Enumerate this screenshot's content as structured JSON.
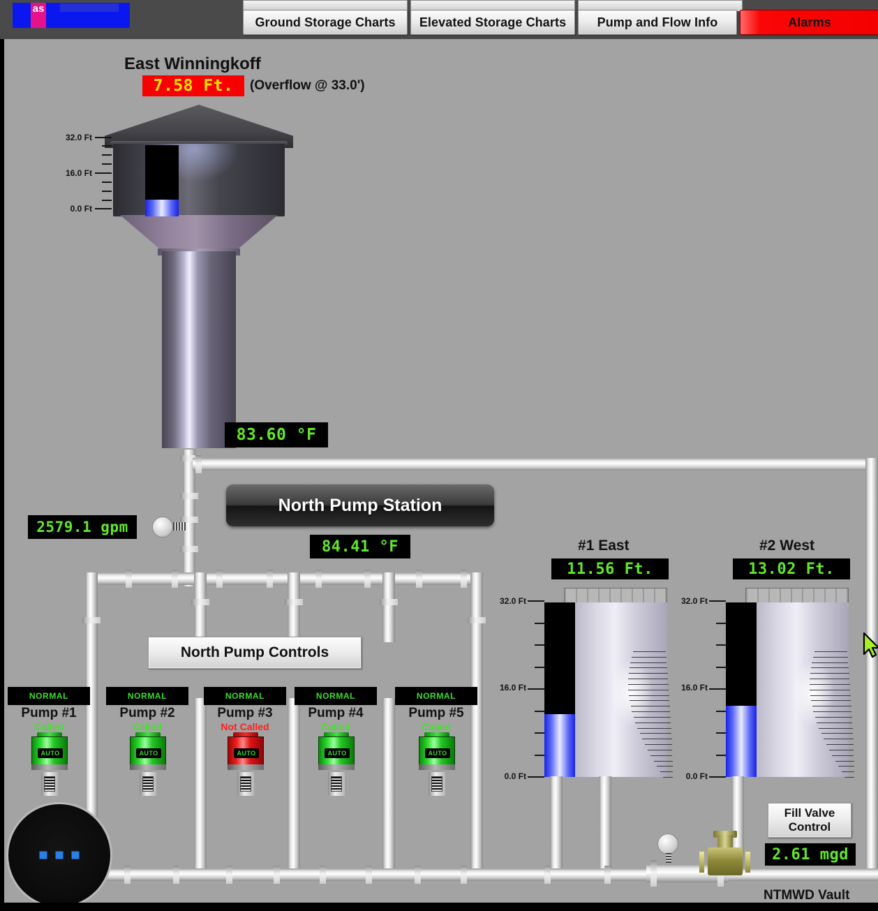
{
  "app": {
    "background_color": "#a3a3a3",
    "logo_text": "as"
  },
  "tabs": [
    {
      "label": "Ground Storage Charts",
      "state": "normal"
    },
    {
      "label": "Elevated Storage Charts",
      "state": "normal"
    },
    {
      "label": "Pump and Flow Info",
      "state": "normal"
    },
    {
      "label": "Alarms",
      "state": "alarm",
      "color": "#f40000"
    }
  ],
  "elevated_tank": {
    "name": "East Winningkoff",
    "level": "7.58 Ft.",
    "level_numeric": 7.58,
    "level_color_bg": "#f90000",
    "level_color_fg": "#ffe400",
    "overflow_note": "(Overflow @ 33.0')",
    "overflow_numeric": 33.0,
    "scale": {
      "top": "32.0 Ft",
      "mid": "16.0 Ft",
      "bottom": "0.0 Ft",
      "max": 32.0,
      "min": 0.0
    },
    "riser_temperature": "83.60 °F"
  },
  "flow": {
    "north_flow": "2579.1 gpm",
    "north_flow_numeric": 2579.1,
    "station_temperature": "84.41 °F"
  },
  "station": {
    "title": "North Pump Station",
    "controls_button": "North Pump Controls"
  },
  "pumps": [
    {
      "status": "NORMAL",
      "name": "Pump #1",
      "called_text": "Called",
      "called": true,
      "mode": "AUTO"
    },
    {
      "status": "NORMAL",
      "name": "Pump #2",
      "called_text": "Called",
      "called": true,
      "mode": "AUTO"
    },
    {
      "status": "NORMAL",
      "name": "Pump #3",
      "called_text": "Not Called",
      "called": false,
      "mode": "AUTO"
    },
    {
      "status": "NORMAL",
      "name": "Pump #4",
      "called_text": "Called",
      "called": true,
      "mode": "AUTO"
    },
    {
      "status": "NORMAL",
      "name": "Pump #5",
      "called_text": "Called",
      "called": true,
      "mode": "AUTO"
    }
  ],
  "ground_tanks": [
    {
      "name": "#1 East",
      "level": "11.56 Ft.",
      "level_numeric": 11.56,
      "scale": {
        "top": "32.0 Ft",
        "mid": "16.0 Ft",
        "bottom": "0.0 Ft",
        "max": 32.0,
        "min": 0.0
      }
    },
    {
      "name": "#2 West",
      "level": "13.02 Ft.",
      "level_numeric": 13.02,
      "scale": {
        "top": "32.0 Ft",
        "mid": "16.0 Ft",
        "bottom": "0.0 Ft",
        "max": 32.0,
        "min": 0.0
      }
    }
  ],
  "fill_valve": {
    "button_line1": "Fill Valve",
    "button_line2": "Control",
    "flow": "2.61 mgd",
    "flow_numeric": 2.61,
    "vault_label": "NTMWD Vault"
  },
  "colors": {
    "lcd_green": "#62e828",
    "alarm_red": "#f40000",
    "water_blue": "#1823e8",
    "called_green": "#46e02f",
    "not_called_red": "#ff2020"
  }
}
